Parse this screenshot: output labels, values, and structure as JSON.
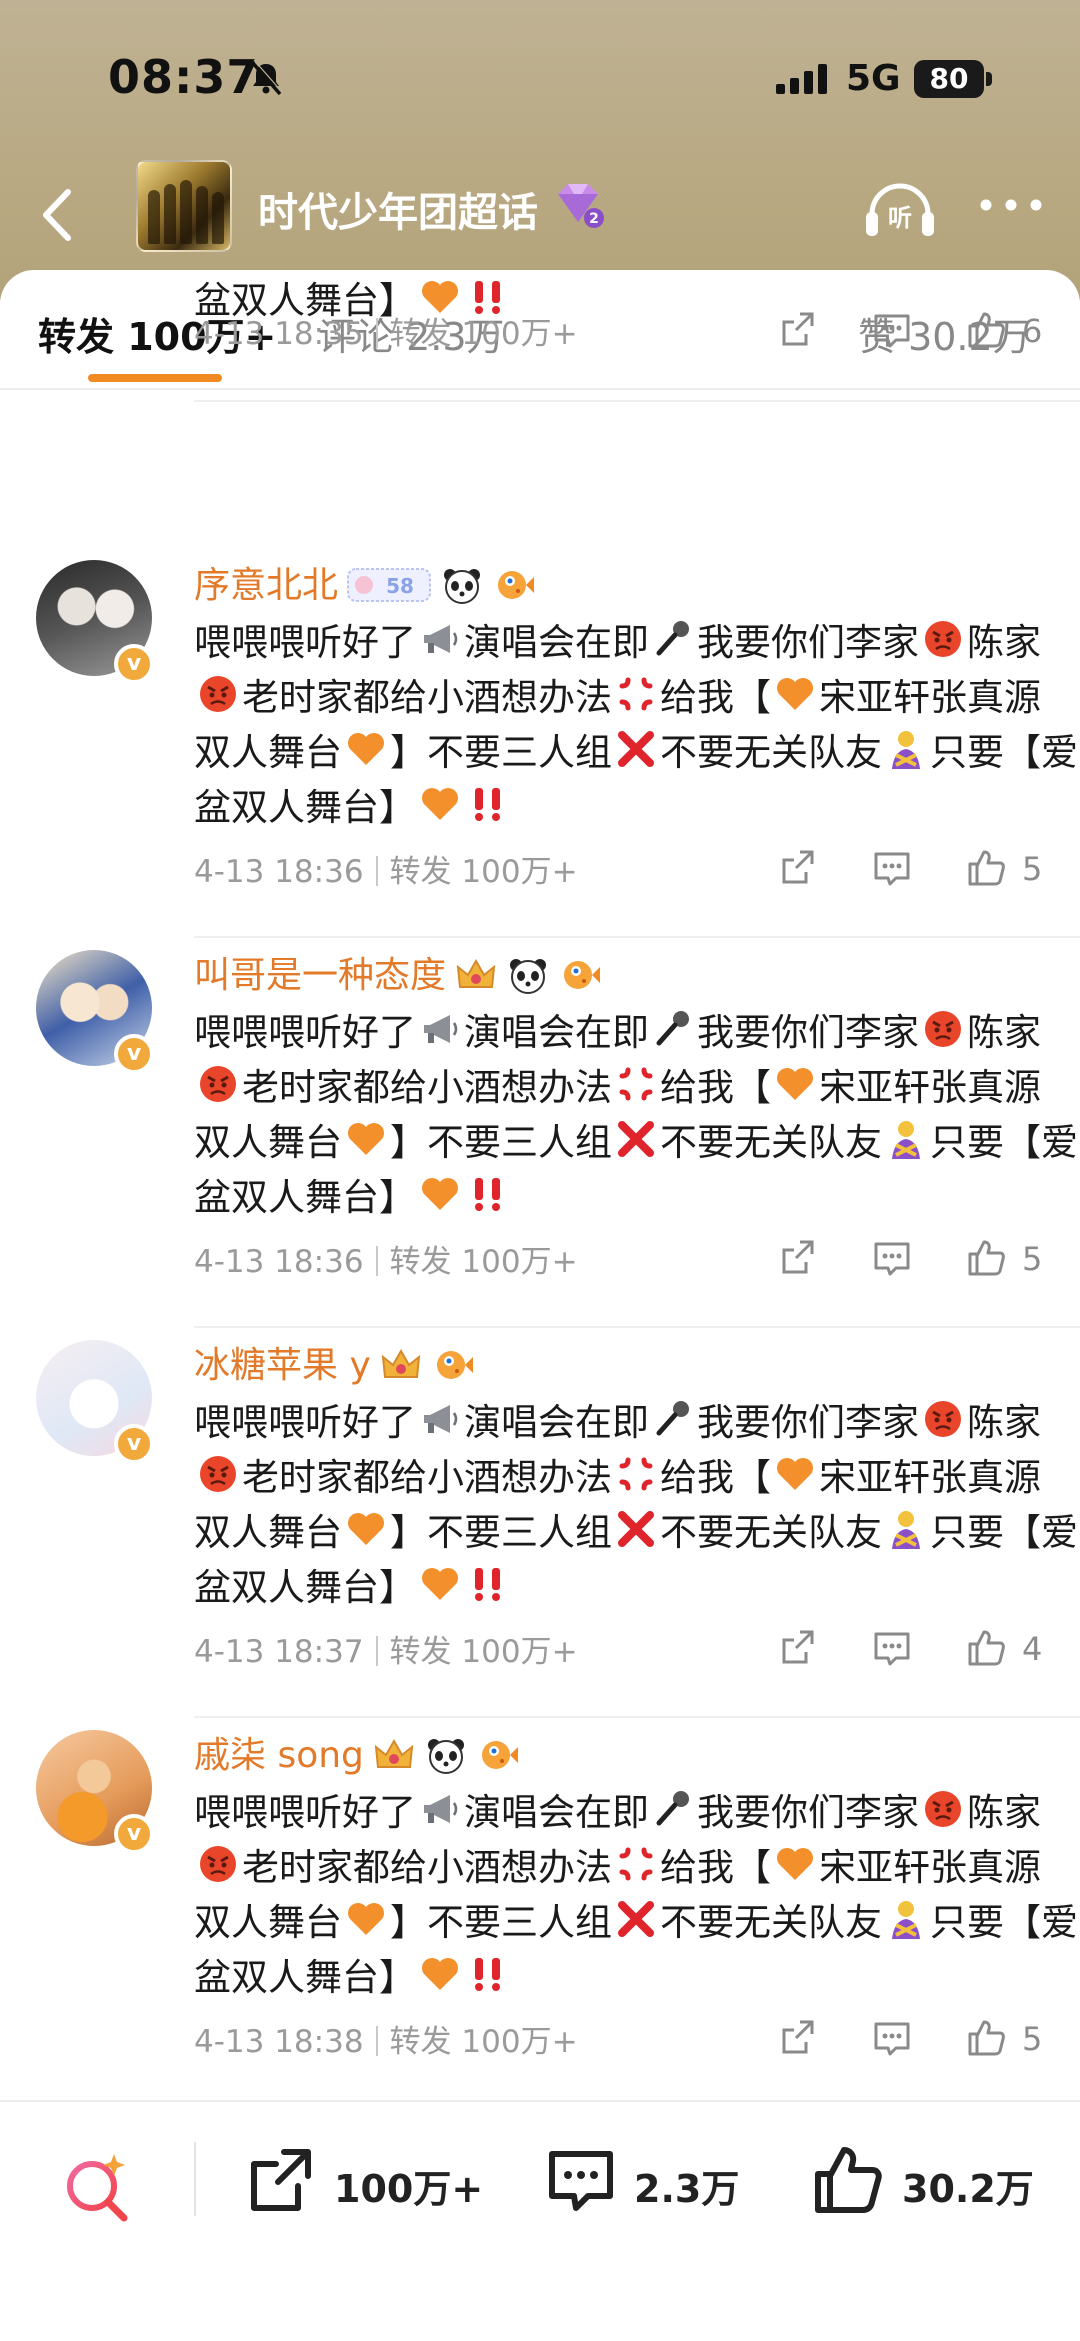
{
  "status_bar": {
    "time": "08:37",
    "network": "5G",
    "battery": "80"
  },
  "nav": {
    "title": "时代少年团超话",
    "gem_level": "2"
  },
  "tabs": {
    "repost": "转发 100万+",
    "comments": "评论 2.3万",
    "likes": "赞 30.2万"
  },
  "partial_item": {
    "text_tail": "盆双人舞台】",
    "date": "4-13 18:35",
    "repost_meta": "转发 100万+",
    "likes": "6"
  },
  "message_parts": {
    "l1a": "喂喂喂听好了",
    "l1b": "演唱会在即",
    "l1c": "我要你们李家",
    "l1d": "陈家",
    "l2a": "老时家都给小酒想办法",
    "l2b": "给我【",
    "l2c": "宋亚轩张真源",
    "l3a": "双人舞台",
    "l3b": "】不要三人组",
    "l3c": "不要无关队友",
    "l3d": "只要【爱",
    "l4a": "盆双人舞台】"
  },
  "comments": [
    {
      "username": "序意北北",
      "badge": "58",
      "date": "4-13 18:36",
      "repost_meta": "转发 100万+",
      "likes": "5"
    },
    {
      "username": "叫哥是一种态度",
      "date": "4-13 18:36",
      "repost_meta": "转发 100万+",
      "likes": "5"
    },
    {
      "username": "冰糖苹果 y",
      "date": "4-13 18:37",
      "repost_meta": "转发 100万+",
      "likes": "4"
    },
    {
      "username": "戚柒 song",
      "date": "4-13 18:38",
      "repost_meta": "转发 100万+",
      "likes": "5"
    }
  ],
  "bottom_bar": {
    "repost": "100万+",
    "comments": "2.3万",
    "likes": "30.2万"
  },
  "colors": {
    "accent": "#f28a24",
    "username": "#e27a2a",
    "header_bg": "#b9aa84"
  }
}
